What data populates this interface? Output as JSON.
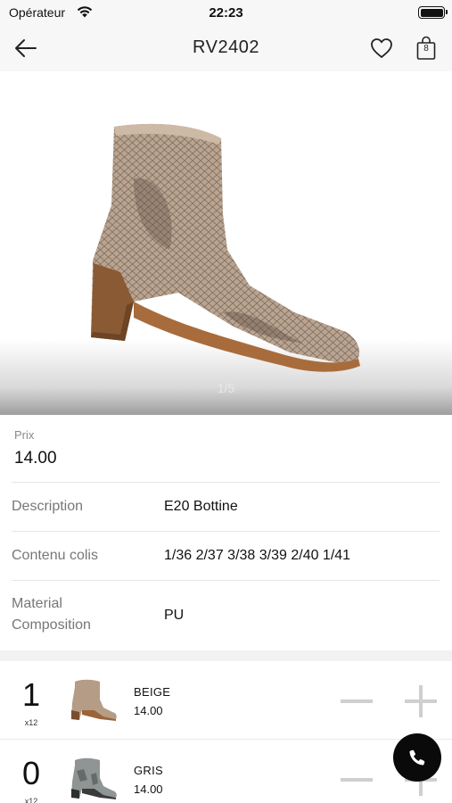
{
  "status_bar": {
    "carrier": "Opérateur",
    "time": "22:23"
  },
  "nav": {
    "title": "RV2402",
    "cart_count": "8",
    "icons": [
      "back-arrow-icon",
      "heart-icon",
      "shopping-bag-icon"
    ]
  },
  "gallery": {
    "pager": "1/5",
    "current_index": 1,
    "total": 5
  },
  "product": {
    "price_label": "Prix",
    "price_value": "14.00",
    "details": [
      {
        "label": "Description",
        "value": "E20 Bottine"
      },
      {
        "label": "Contenu colis",
        "value": "1/36 2/37 3/38 3/39 2/40 1/41"
      },
      {
        "label": "Material Composition",
        "value": "PU"
      }
    ]
  },
  "variants": [
    {
      "quantity": "1",
      "multiplier": "x12",
      "color": "BEIGE",
      "price": "14.00",
      "swatch": "#b59c86"
    },
    {
      "quantity": "0",
      "multiplier": "x12",
      "color": "GRIS",
      "price": "14.00",
      "swatch": "#8f9494"
    }
  ],
  "colors": {
    "fab_background": "#0a0a0a",
    "stepper": "#cfcfcf"
  },
  "fab": {
    "icon": "phone-icon"
  }
}
